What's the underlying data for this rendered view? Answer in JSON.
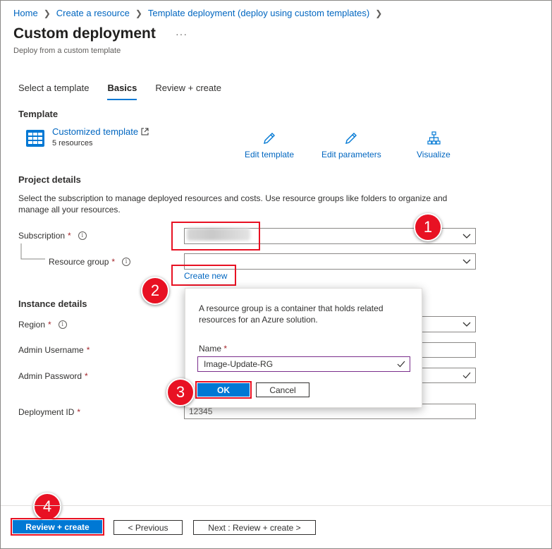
{
  "breadcrumb": {
    "items": [
      "Home",
      "Create a resource",
      "Template deployment (deploy using custom templates)"
    ]
  },
  "page": {
    "title": "Custom deployment",
    "more": "···",
    "subtitle": "Deploy from a custom template"
  },
  "tabs": [
    {
      "label": "Select a template",
      "active": false
    },
    {
      "label": "Basics",
      "active": true
    },
    {
      "label": "Review + create",
      "active": false
    }
  ],
  "template": {
    "heading": "Template",
    "name": "Customized template",
    "count": "5 resources",
    "actions": {
      "edit_template": "Edit template",
      "edit_parameters": "Edit parameters",
      "visualize": "Visualize"
    }
  },
  "project": {
    "heading": "Project details",
    "description": "Select the subscription to manage deployed resources and costs. Use resource groups like folders to organize and manage all your resources.",
    "subscription_label": "Subscription",
    "resource_group_label": "Resource group",
    "create_new": "Create new",
    "required_mark": "*"
  },
  "instance": {
    "heading": "Instance details",
    "region_label": "Region",
    "admin_username_label": "Admin Username",
    "admin_password_label": "Admin Password",
    "deployment_id_label": "Deployment ID",
    "deployment_id_value": "12345"
  },
  "popup": {
    "message": "A resource group is a container that holds related resources for an Azure solution.",
    "name_label": "Name",
    "name_value": "Image-Update-RG",
    "ok": "OK",
    "cancel": "Cancel"
  },
  "footer": {
    "review_create": "Review + create",
    "previous": "< Previous",
    "next": "Next : Review + create >"
  },
  "callouts": [
    "1",
    "2",
    "3",
    "4"
  ],
  "colors": {
    "link": "#0066c0",
    "accent": "#0078d4",
    "highlight": "#e81123",
    "required": "#a4262c"
  }
}
